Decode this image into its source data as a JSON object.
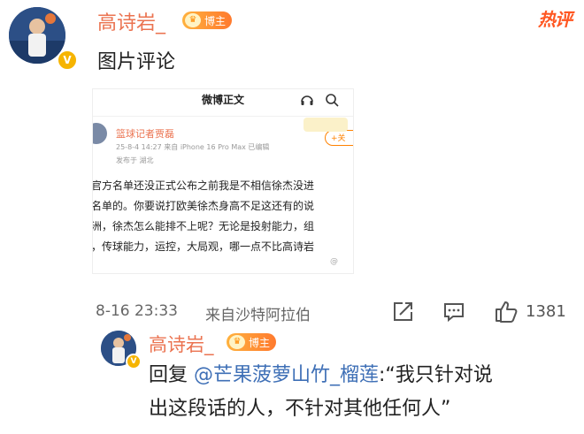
{
  "post": {
    "author": "高诗岩_",
    "badge": "博主",
    "hot_label": "热评",
    "content": "图片评论",
    "timestamp": "8-16 23:33",
    "source": "来自沙特阿拉伯",
    "like_count": "1381"
  },
  "screenshot": {
    "header_title": "微博正文",
    "user": "篮球记者贾磊",
    "time_line": "25-8-4 14:27  来自 iPhone 16 Pro Max  已编辑",
    "location": "发布于 湖北",
    "follow_label": "+关",
    "lines": [
      "官方名单还没正式公布之前我是不相信徐杰没进",
      "名单的。你要说打欧美徐杰身高不足这还有的说",
      "洲，徐杰怎么能排不上呢？无论是投射能力，组",
      "，传球能力，运控，大局观，哪一点不比高诗岩"
    ],
    "watermark": "@"
  },
  "reply": {
    "author": "高诗岩_",
    "badge": "博主",
    "prefix": "回复 ",
    "mention": "@芒果菠萝山竹_榴莲",
    "text_line1_tail": ":“我只针对说",
    "text_line2": "出这段话的人，不针对其他任何人”"
  },
  "colors": {
    "name": "#eb7350",
    "link": "#3e6fb6",
    "hot": "#ff5722",
    "badge": "#ff8a2e"
  }
}
